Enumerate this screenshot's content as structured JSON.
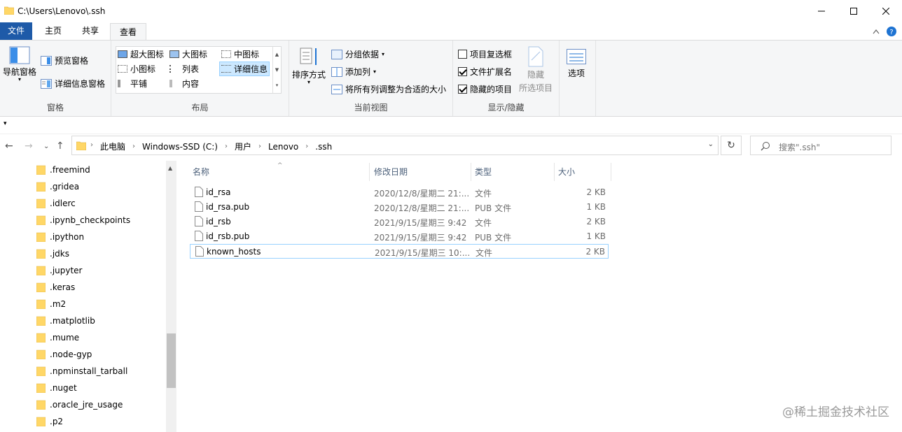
{
  "window": {
    "title": "C:\\Users\\Lenovo\\.ssh"
  },
  "tabs": [
    "文件",
    "主页",
    "共享",
    "查看"
  ],
  "ribbon": {
    "panes": {
      "nav_pane": "导航窗格",
      "preview_pane": "预览窗格",
      "details_pane": "详细信息窗格",
      "label": "窗格"
    },
    "layout": {
      "items": [
        "超大图标",
        "大图标",
        "中图标",
        "小图标",
        "列表",
        "详细信息",
        "平铺",
        "内容"
      ],
      "selected": "详细信息",
      "label": "布局"
    },
    "current_view": {
      "sort_by": "排序方式",
      "group_by": "分组依据",
      "add_columns": "添加列",
      "fit_columns": "将所有列调整为合适的大小",
      "label": "当前视图"
    },
    "show_hide": {
      "item_checkboxes": "项目复选框",
      "file_extensions": "文件扩展名",
      "hidden_items": "隐藏的项目",
      "hide_selected_1": "隐藏",
      "hide_selected_2": "所选项目",
      "label": "显示/隐藏",
      "checks": {
        "item_checkboxes": false,
        "file_extensions": true,
        "hidden_items": true
      }
    },
    "options": "选项"
  },
  "address": {
    "crumbs": [
      "此电脑",
      "Windows-SSD (C:)",
      "用户",
      "Lenovo",
      ".ssh"
    ]
  },
  "search": {
    "placeholder": "搜索\".ssh\""
  },
  "tree": [
    ".freemind",
    ".gridea",
    ".idlerc",
    ".ipynb_checkpoints",
    ".ipython",
    ".jdks",
    ".jupyter",
    ".keras",
    ".m2",
    ".matplotlib",
    ".mume",
    ".node-gyp",
    ".npminstall_tarball",
    ".nuget",
    ".oracle_jre_usage",
    ".p2"
  ],
  "columns": {
    "name": "名称",
    "modified": "修改日期",
    "type": "类型",
    "size": "大小"
  },
  "files": [
    {
      "name": "id_rsa",
      "modified": "2020/12/8/星期二 21:...",
      "type": "文件",
      "size": "2 KB"
    },
    {
      "name": "id_rsa.pub",
      "modified": "2020/12/8/星期二 21:...",
      "type": "PUB 文件",
      "size": "1 KB"
    },
    {
      "name": "id_rsb",
      "modified": "2021/9/15/星期三 9:42",
      "type": "文件",
      "size": "2 KB"
    },
    {
      "name": "id_rsb.pub",
      "modified": "2021/9/15/星期三 9:42",
      "type": "PUB 文件",
      "size": "1 KB"
    },
    {
      "name": "known_hosts",
      "modified": "2021/9/15/星期三 10:...",
      "type": "文件",
      "size": "2 KB"
    }
  ],
  "watermark": "@稀土掘金技术社区",
  "colors": {
    "accent": "#0078d7",
    "selection": "#cce8ff",
    "folder": "#ffd767"
  }
}
